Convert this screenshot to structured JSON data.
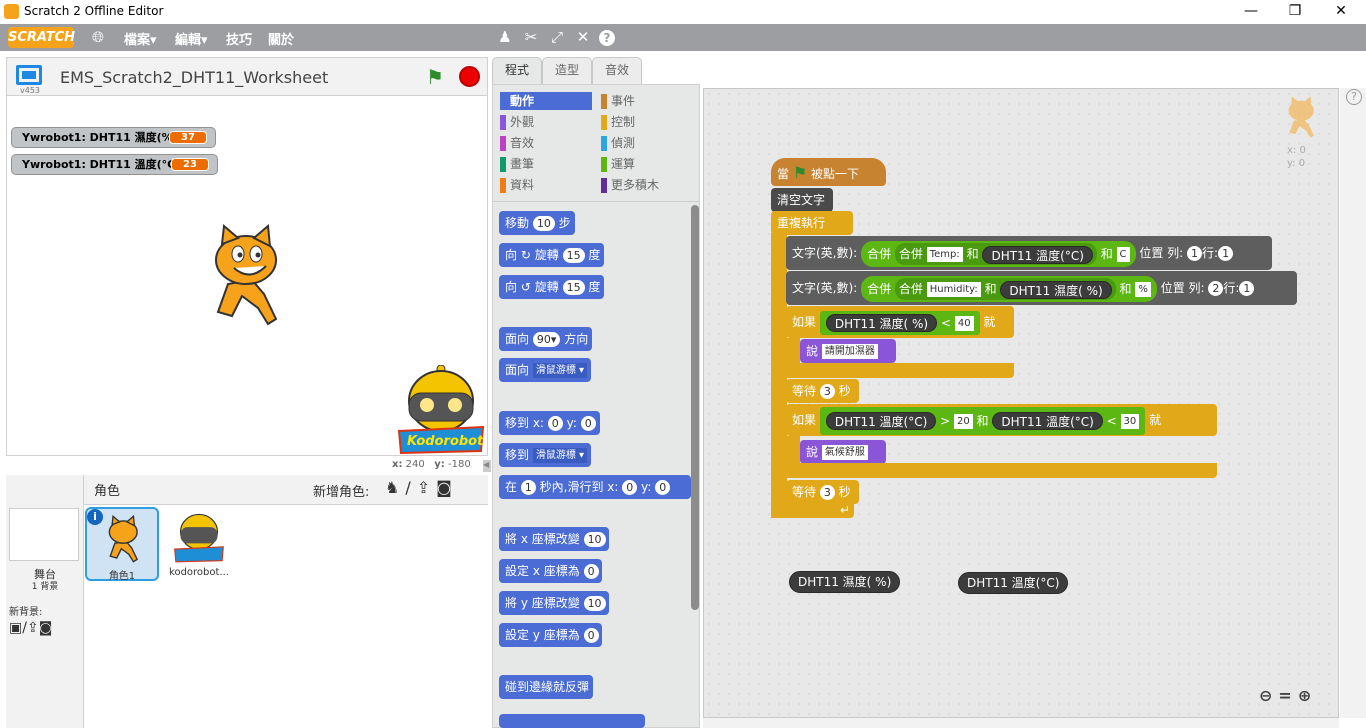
{
  "window": {
    "title": "Scratch 2 Offline Editor",
    "min": "—",
    "max": "❐",
    "close": "✕"
  },
  "menubar": {
    "logo": "SCRATCH",
    "items": [
      "檔案▾",
      "編輯▾",
      "技巧",
      "關於"
    ],
    "tools": [
      "duplicate-icon",
      "delete-icon",
      "grow-icon",
      "shrink-icon",
      "help-icon"
    ]
  },
  "stage": {
    "title": "EMS_Scratch2_DHT11_Worksheet",
    "version": "v453",
    "monitors": [
      {
        "label": "Ywrobot1: DHT11 濕度(%)",
        "value": "37"
      },
      {
        "label": "Ywrobot1: DHT11 溫度(°C)",
        "value": "23"
      }
    ],
    "coords": {
      "x_label": "x:",
      "x": "240",
      "y_label": "y:",
      "y": "-180"
    }
  },
  "sprites": {
    "header": "角色",
    "new_sprite": "新增角色:",
    "stage_label": "舞台",
    "backdrops": "1 背景",
    "new_backdrop": "新背景:",
    "items": [
      "角色1",
      "kodorobot..."
    ]
  },
  "tabs": [
    "程式",
    "造型",
    "音效"
  ],
  "categories": {
    "left": [
      {
        "label": "動作",
        "color": "#4a6cd4"
      },
      {
        "label": "外觀",
        "color": "#8a55d7"
      },
      {
        "label": "音效",
        "color": "#bb42c3"
      },
      {
        "label": "畫筆",
        "color": "#0e9a6c"
      },
      {
        "label": "資料",
        "color": "#ee7d16"
      }
    ],
    "right": [
      {
        "label": "事件",
        "color": "#c88330"
      },
      {
        "label": "控制",
        "color": "#e1a91a"
      },
      {
        "label": "偵測",
        "color": "#2ca5e2"
      },
      {
        "label": "運算",
        "color": "#5cb712"
      },
      {
        "label": "更多積木",
        "color": "#632d99"
      }
    ]
  },
  "palette": {
    "move": "移動",
    "move_n": "10",
    "move_u": "步",
    "turn_r": "向",
    "turn_r2": "旋轉",
    "turn_n": "15",
    "turn_u": "度",
    "turn_l": "向",
    "turn_l2": "旋轉",
    "turn_ln": "15",
    "turn_lu": "度",
    "point": "面向",
    "point_n": "90▾",
    "point_u": "方向",
    "point_to": "面向",
    "point_to_v": "滑鼠游標 ▾",
    "goto": "移到 x:",
    "goto_x": "0",
    "goto_y_l": "y:",
    "goto_y": "0",
    "goto2": "移到",
    "goto2_v": "滑鼠游標 ▾",
    "glide": "在",
    "glide_n": "1",
    "glide_t": "秒內,滑行到 x:",
    "glide_x": "0",
    "glide_yl": "y:",
    "glide_y": "0",
    "chx": "將 x 座標改變",
    "chx_n": "10",
    "setx": "設定 x 座標為",
    "setx_n": "0",
    "chy": "將 y 座標改變",
    "chy_n": "10",
    "sety": "設定 y 座標為",
    "sety_n": "0",
    "bounce": "碰到邊緣就反彈"
  },
  "script": {
    "hat": "當",
    "hat2": "被點一下",
    "clear": "清空文字",
    "forever": "重複執行",
    "row1": {
      "lbl": "文字(英,數):",
      "join": "合併",
      "join2": "合併",
      "s1": "Temp:",
      "and": "和",
      "r1": "DHT11 溫度(°C)",
      "and2": "和",
      "s2": "C",
      "pos": "位置 列:",
      "row": "1",
      "col_l": "行:",
      "col": "1"
    },
    "row2": {
      "lbl": "文字(英,數):",
      "join": "合併",
      "join2": "合併",
      "s1": "Humidity:",
      "and": "和",
      "r1": "DHT11 濕度( %)",
      "and2": "和",
      "s2": "%",
      "pos": "位置 列:",
      "row": "2",
      "col_l": "行:",
      "col": "1"
    },
    "if1": {
      "if": "如果",
      "rep": "DHT11 濕度( %)",
      "op": "<",
      "val": "40",
      "then": "就",
      "say": "說",
      "msg": "請開加濕器"
    },
    "wait1": {
      "l": "等待",
      "n": "3",
      "u": "秒"
    },
    "if2": {
      "if": "如果",
      "rep1": "DHT11 溫度(°C)",
      "op1": ">",
      "v1": "20",
      "and": "和",
      "rep2": "DHT11 溫度(°C)",
      "op2": "<",
      "v2": "30",
      "then": "就",
      "say": "說",
      "msg": "氣候舒服"
    },
    "wait2": {
      "l": "等待",
      "n": "3",
      "u": "秒"
    },
    "loose1": "DHT11 濕度( %)",
    "loose2": "DHT11 溫度(°C)",
    "sprite_xy": {
      "x": "x: 0",
      "y": "y: 0"
    }
  }
}
